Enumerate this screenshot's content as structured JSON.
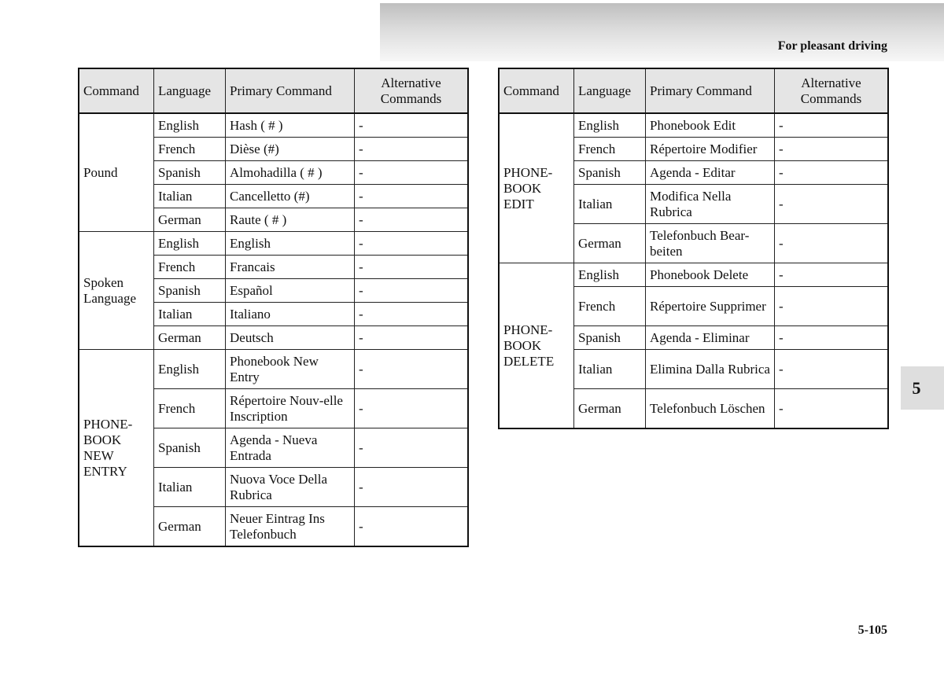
{
  "header": {
    "section_title": "For pleasant driving"
  },
  "chapter_tab": "5",
  "page_number": "5-105",
  "columns": [
    "Command",
    "Language",
    "Primary Command",
    "Alternative\nCommands"
  ],
  "left_table": [
    {
      "command": "Pound",
      "rows": [
        {
          "language": "English",
          "primary": "Hash ( # )",
          "alt": "-"
        },
        {
          "language": "French",
          "primary": "Dièse (#)",
          "alt": "-"
        },
        {
          "language": "Spanish",
          "primary": "Almohadilla ( # )",
          "alt": "-"
        },
        {
          "language": "Italian",
          "primary": "Cancelletto (#)",
          "alt": "-"
        },
        {
          "language": "German",
          "primary": "Raute ( # )",
          "alt": "-"
        }
      ]
    },
    {
      "command": "Spoken\nLanguage",
      "rows": [
        {
          "language": "English",
          "primary": "English",
          "alt": "-"
        },
        {
          "language": "French",
          "primary": "Francais",
          "alt": "-"
        },
        {
          "language": "Spanish",
          "primary": "Español",
          "alt": "-"
        },
        {
          "language": "Italian",
          "primary": "Italiano",
          "alt": "-"
        },
        {
          "language": "German",
          "primary": "Deutsch",
          "alt": "-"
        }
      ]
    },
    {
      "command": "PHONE-\nBOOK\nNEW\nENTRY",
      "rows": [
        {
          "language": "English",
          "primary": "Phonebook New Entry",
          "alt": "-",
          "tall": true
        },
        {
          "language": "French",
          "primary": "Répertoire Nouv-elle Inscription",
          "alt": "-",
          "tall": true
        },
        {
          "language": "Spanish",
          "primary": "Agenda - Nueva Entrada",
          "alt": "-",
          "tall": true
        },
        {
          "language": "Italian",
          "primary": "Nuova Voce Della Rubrica",
          "alt": "-",
          "tall": true
        },
        {
          "language": "German",
          "primary": "Neuer Eintrag Ins Telefonbuch",
          "alt": "-",
          "tall": true
        }
      ]
    }
  ],
  "right_table": [
    {
      "command": "PHONE-\nBOOK\nEDIT",
      "rows": [
        {
          "language": "English",
          "primary": "Phonebook Edit",
          "alt": "-"
        },
        {
          "language": "French",
          "primary": "Répertoire Modifier",
          "alt": "-"
        },
        {
          "language": "Spanish",
          "primary": "Agenda - Editar",
          "alt": "-"
        },
        {
          "language": "Italian",
          "primary": "Modifica Nella Rubrica",
          "alt": "-",
          "tall": true
        },
        {
          "language": "German",
          "primary": "Telefonbuch Bear-beiten",
          "alt": "-",
          "tall": true
        }
      ]
    },
    {
      "command": "PHONE-\nBOOK\nDELETE",
      "rows": [
        {
          "language": "English",
          "primary": "Phonebook Delete",
          "alt": "-"
        },
        {
          "language": "French",
          "primary": "Répertoire Supprimer",
          "alt": "-",
          "tall": true
        },
        {
          "language": "Spanish",
          "primary": "Agenda - Eliminar",
          "alt": "-"
        },
        {
          "language": "Italian",
          "primary": "Elimina Dalla Rubrica",
          "alt": "-",
          "tall": true
        },
        {
          "language": "German",
          "primary": "Telefonbuch Löschen",
          "alt": "-",
          "tall": true
        }
      ]
    }
  ]
}
